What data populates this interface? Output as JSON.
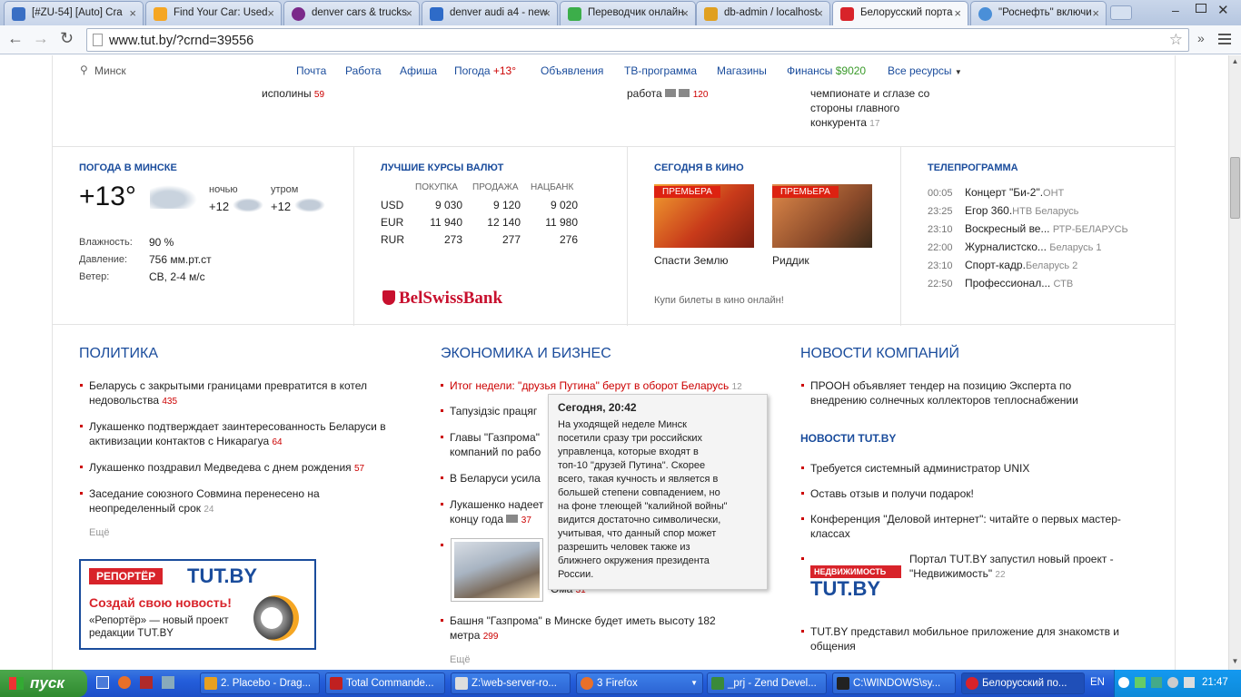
{
  "tabs": [
    {
      "title": "[#ZU-54] [Auto] Cra",
      "color": "#3a6fc4"
    },
    {
      "title": "Find Your Car: Used",
      "color": "#f5a623"
    },
    {
      "title": "denver cars & trucks",
      "color": "#7b2a8a"
    },
    {
      "title": "denver audi a4 - new",
      "color": "#2e6bc8"
    },
    {
      "title": "Переводчик онлайн",
      "color": "#3cae4a"
    },
    {
      "title": "db-admin / localhost",
      "color": "#e0a020"
    },
    {
      "title": "Белорусский порта",
      "color": "#d8232a"
    },
    {
      "title": "\"Роснефть\" включи",
      "color": "#4a8fd8"
    }
  ],
  "url": "www.tut.by/?crnd=39556",
  "nav": {
    "city": "Минск",
    "links": [
      "Почта",
      "Работа",
      "Афиша",
      "Погода",
      "Объявления",
      "ТВ-программа",
      "Магазины",
      "Финансы",
      "Все ресурсы"
    ],
    "weather_temp": "+13°",
    "finance_value": "$9020"
  },
  "top_frag": {
    "a": "исполины",
    "a_num": "59",
    "b": "работа",
    "b_num": "120",
    "c1": "чемпионате и сглазе со",
    "c2": "стороны главного",
    "c3": "конкурента",
    "c_num": "17"
  },
  "weather": {
    "title": "ПОГОДА В МИНСКЕ",
    "temp": "+13°",
    "night_label": "ночью",
    "night_temp": "+12",
    "morning_label": "утром",
    "morning_temp": "+12",
    "humidity_label": "Влажность:",
    "humidity": "90 %",
    "pressure_label": "Давление:",
    "pressure": "756 мм.рт.ст",
    "wind_label": "Ветер:",
    "wind": "СВ, 2-4 м/с"
  },
  "rates": {
    "title": "ЛУЧШИЕ КУРСЫ ВАЛЮТ",
    "headers": [
      "ПОКУПКА",
      "ПРОДАЖА",
      "НАЦБАНК"
    ],
    "rows": [
      [
        "USD",
        "9 030",
        "9 120",
        "9 020"
      ],
      [
        "EUR",
        "11 940",
        "12 140",
        "11 980"
      ],
      [
        "RUR",
        "273",
        "277",
        "276"
      ]
    ],
    "bank": "BelSwissBank"
  },
  "cinema": {
    "title": "СЕГОДНЯ В КИНО",
    "badge": "ПРЕМЬЕРА",
    "movies": [
      "Спасти Землю",
      "Риддик"
    ],
    "link": "Купи билеты в кино онлайн!"
  },
  "tv": {
    "title": "ТЕЛЕПРОГРАММА",
    "rows": [
      [
        "00:05",
        "Концерт \"Би-2\".",
        "ОНТ"
      ],
      [
        "23:25",
        "Егор 360.",
        "НТВ Беларусь"
      ],
      [
        "23:10",
        "Воскресный ве...",
        "РТР-БЕЛАРУСЬ"
      ],
      [
        "22:00",
        "Журналистско...",
        "Беларусь 1"
      ],
      [
        "23:10",
        "Спорт-кадр.",
        "Беларусь 2"
      ],
      [
        "22:50",
        "Профессионал...",
        "СТВ"
      ]
    ]
  },
  "politics": {
    "title": "ПОЛИТИКА",
    "items": [
      {
        "t1": "Беларусь с закрытыми границами превратится в котел",
        "t2": "недовольства",
        "n": "435"
      },
      {
        "t1": "Лукашенко подтверждает заинтересованность Беларуси в",
        "t2": "активизации контактов с Никарагуа",
        "n": "64"
      },
      {
        "t1": "Лукашенко поздравил Медведева с днем рождения",
        "t2": "",
        "n": "57"
      },
      {
        "t1": "Заседание союзного Совмина перенесено на",
        "t2": "неопределенный срок",
        "n": "24"
      }
    ],
    "more": "Ещё"
  },
  "economy": {
    "title": "ЭКОНОМИКА И БИЗНЕС",
    "items": [
      {
        "t1": "Итог недели: \"друзья Путина\" берут в оборот Беларусь",
        "n": "12"
      },
      {
        "t1": "Тапузідзіс працяг"
      },
      {
        "t1": "Главы \"Газпрома\"",
        "t2": "компаний по рабо"
      },
      {
        "t1": "В Беларуси усила"
      },
      {
        "t1": "Лукашенко надеет",
        "t2": "концу года",
        "n": "37"
      },
      {
        "t1": "Ома",
        "n": "31"
      },
      {
        "t1": "Башня \"Газпрома\" в Минске будет иметь высоту 182",
        "t2": "метра",
        "n": "299"
      }
    ],
    "more": "Ещё"
  },
  "tooltip": {
    "title": "Сегодня, 20:42",
    "lines": [
      "На уходящей неделе Минск",
      "посетили сразу три российских",
      "управленца, которые входят в",
      "топ-10 \"друзей Путина\". Скорее",
      "всего, такая кучность и является в",
      "большей степени совпадением, но",
      "на фоне тлеющей \"калийной войны\"",
      "видится достаточно символически,",
      "учитывая, что данный спор может",
      "разрешить человек также из",
      "ближнего окружения президента",
      "России."
    ]
  },
  "companies": {
    "title": "НОВОСТИ КОМПАНИЙ",
    "item1": "ПРООН объявляет тендер на позицию Эксперта по",
    "item1b": "внедрению солнечных коллекторов теплоснабжении",
    "tutby_title": "НОВОСТИ TUT.BY",
    "items": [
      "Требуется системный администратор UNIX",
      "Оставь отзыв и получи подарок!",
      "Конференция \"Деловой интернет\": читайте о первых мастер-"
    ],
    "item3b": "классах",
    "portal1": "Портал TUT.BY запустил новый проект -",
    "portal2": "\"Недвижимость\"",
    "portal_n": "22",
    "nedv_badge": "НЕДВИЖИМОСТЬ",
    "app1": "TUT.BY представил мобильное приложение для знакомств и",
    "app2": "общения"
  },
  "reporter": {
    "badge": "РЕПОРТЁР",
    "logo": "TUT.BY",
    "slogan": "Создай свою новость!",
    "desc1": "«Репортёр» — новый проект",
    "desc2": "редакции TUT.BY"
  },
  "taskbar": {
    "start": "пуск",
    "items": [
      "2. Placebo - Drag...",
      "Total Commande...",
      "Z:\\web-server-ro...",
      "3 Firefox",
      "_prj - Zend Devel...",
      "C:\\WINDOWS\\sy...",
      "Белорусский по..."
    ],
    "lang": "EN",
    "clock": "21:47"
  }
}
